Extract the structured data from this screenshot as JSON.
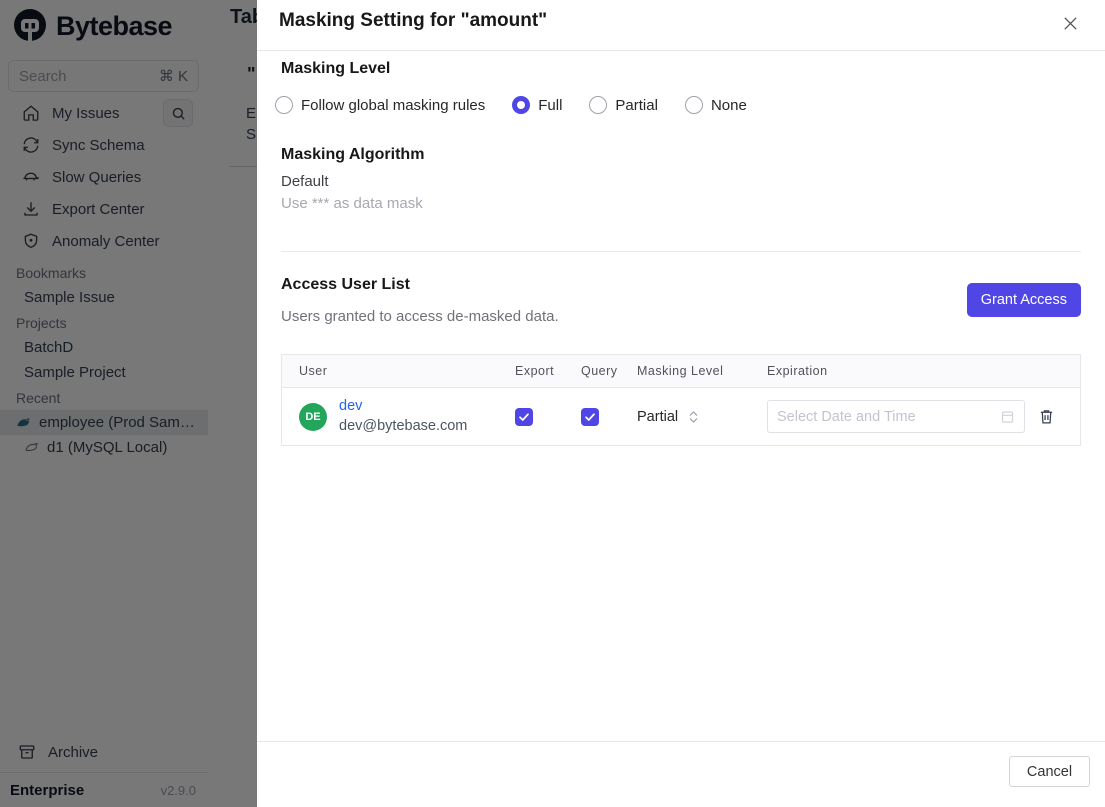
{
  "sidebar": {
    "logo_text": "Bytebase",
    "search": {
      "placeholder": "Search",
      "shortcut": "⌘ K"
    },
    "nav": [
      {
        "label": "My Issues",
        "icon": "home-icon"
      },
      {
        "label": "Sync Schema",
        "icon": "sync-icon"
      },
      {
        "label": "Slow Queries",
        "icon": "turtle-icon"
      },
      {
        "label": "Export Center",
        "icon": "download-icon"
      },
      {
        "label": "Anomaly Center",
        "icon": "shield-icon"
      }
    ],
    "sections": [
      {
        "label": "Bookmarks",
        "items": [
          {
            "label": "Sample Issue"
          }
        ]
      },
      {
        "label": "Projects",
        "items": [
          {
            "label": "BatchD"
          },
          {
            "label": "Sample Project"
          }
        ]
      },
      {
        "label": "Recent",
        "items": [
          {
            "label": "employee (Prod Sam…",
            "icon": "mysql-dolphin-icon",
            "selected": true
          },
          {
            "label": "d1 (MySQL Local)",
            "icon": "dolphin-outline-icon",
            "selected": false
          }
        ]
      }
    ],
    "footer": {
      "archive_label": "Archive",
      "plan": "Enterprise",
      "version": "v2.9.0"
    }
  },
  "background": {
    "page_title_fragment": "Tab",
    "fragment_quote": "\"",
    "fragment_e": "E",
    "fragment_s": "S"
  },
  "modal": {
    "title": "Masking Setting for \"amount\"",
    "masking_level": {
      "heading": "Masking Level",
      "options": [
        {
          "label": "Follow global masking rules",
          "selected": false
        },
        {
          "label": "Full",
          "selected": true
        },
        {
          "label": "Partial",
          "selected": false
        },
        {
          "label": "None",
          "selected": false
        }
      ]
    },
    "masking_algorithm": {
      "heading": "Masking Algorithm",
      "value": "Default",
      "description": "Use *** as data mask"
    },
    "access_user_list": {
      "heading": "Access User List",
      "description": "Users granted to access de-masked data.",
      "grant_button_label": "Grant Access",
      "table": {
        "headers": [
          "User",
          "Export",
          "Query",
          "Masking Level",
          "Expiration"
        ],
        "rows": [
          {
            "avatar_initials": "DE",
            "name": "dev",
            "email": "dev@bytebase.com",
            "export_checked": true,
            "query_checked": true,
            "masking_level": "Partial",
            "expiration_value": "",
            "expiration_placeholder": "Select Date and Time"
          }
        ]
      }
    },
    "footer": {
      "cancel_label": "Cancel"
    }
  },
  "icons": {
    "home-icon": "house glyph",
    "sync-icon": "circular arrows",
    "turtle-icon": "turtle",
    "download-icon": "download tray",
    "shield-icon": "shield",
    "search-icon": "magnifier",
    "mysql-dolphin-icon": "blue dolphin",
    "dolphin-outline-icon": "gray dolphin",
    "archive-icon": "archive box",
    "close-icon": "x mark",
    "checkmark-icon": "check",
    "chevron-updown-icon": "up/down chevrons",
    "calendar-icon": "calendar",
    "trash-icon": "trash can"
  },
  "colors": {
    "accent": "#4f46e5",
    "link_blue": "#2563eb",
    "avatar_green": "#23a55c",
    "overlay": "rgba(0,0,0,0.53)"
  }
}
